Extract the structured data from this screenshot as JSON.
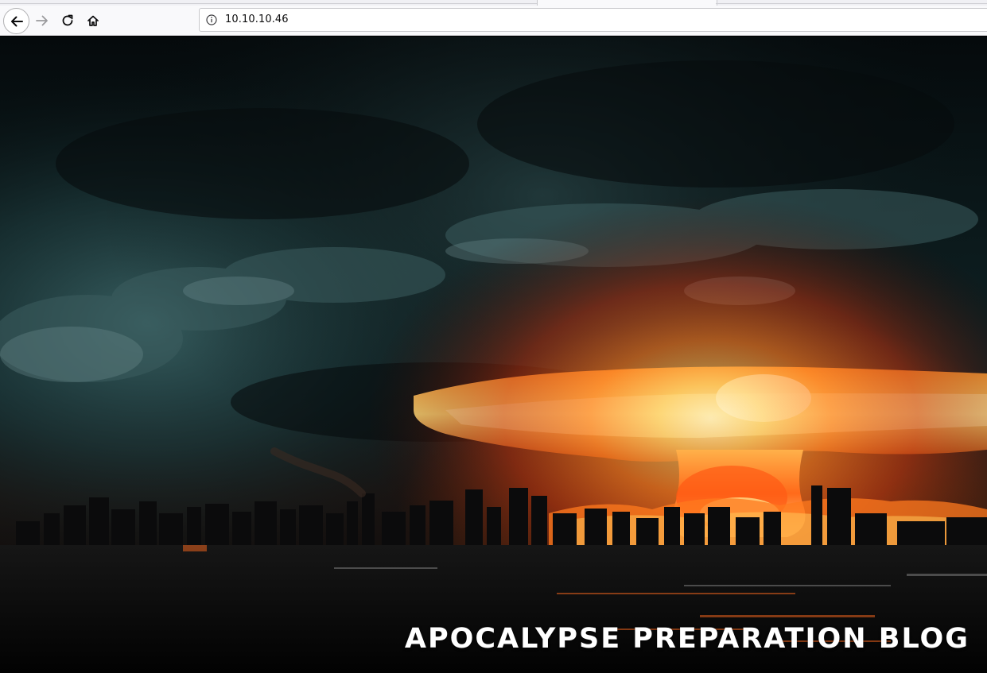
{
  "browser": {
    "url": "10.10.10.46",
    "icons": {
      "back": "back-arrow-icon",
      "forward": "forward-arrow-icon",
      "reload": "reload-icon",
      "home": "home-icon",
      "site_info": "info-icon"
    }
  },
  "page": {
    "title": "APOCALYPSE PREPARATION BLOG",
    "hero_image": "nuclear-explosion-city-skyline"
  }
}
